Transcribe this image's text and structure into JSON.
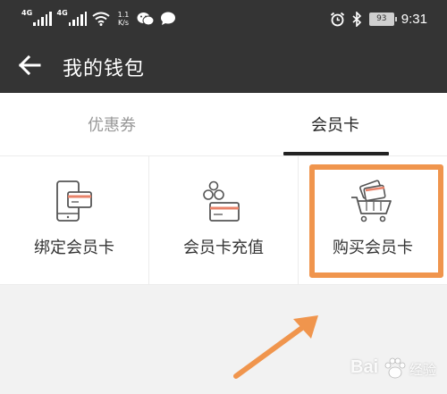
{
  "status_bar": {
    "signal_1_label": "4G",
    "signal_2_label": "4G",
    "speed_value": "1.1",
    "speed_unit": "K/s",
    "battery": "93",
    "time": "9:31"
  },
  "header": {
    "title": "我的钱包"
  },
  "tabs": [
    {
      "label": "优惠券",
      "active": false
    },
    {
      "label": "会员卡",
      "active": true
    }
  ],
  "grid": [
    {
      "label": "绑定会员卡",
      "icon": "phone-card-icon"
    },
    {
      "label": "会员卡充值",
      "icon": "coins-card-icon"
    },
    {
      "label": "购买会员卡",
      "icon": "cart-card-icon"
    }
  ],
  "annotation": {
    "color": "#f0954d"
  },
  "watermark": {
    "text": "Bai",
    "text_cn": "经验"
  }
}
